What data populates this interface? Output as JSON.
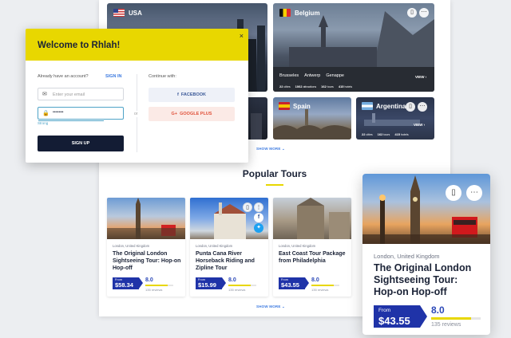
{
  "destinations": [
    {
      "name": "USA",
      "flag": "us"
    },
    {
      "name": "Belgium",
      "flag": "be",
      "cities": [
        "Brusseles",
        "Antwerp",
        "Genappe"
      ],
      "stats": [
        {
          "n": "22",
          "l": "cities"
        },
        {
          "n": "1062",
          "l": "attractions"
        },
        {
          "n": "162",
          "l": "tours"
        },
        {
          "n": "415",
          "l": "hotels"
        }
      ],
      "view": "VIEW ›"
    },
    {
      "name": "Spain",
      "flag": "es"
    },
    {
      "name": "Argentina",
      "flag": "ar",
      "stats": [
        {
          "n": "22",
          "l": "cities"
        },
        {
          "n": "162",
          "l": "tours"
        },
        {
          "n": "415",
          "l": "hotels"
        }
      ],
      "view": "VIEW ›"
    }
  ],
  "show_more_1": "SHOW MORE ⌄",
  "popular": {
    "title": "Popular Tours",
    "cards": [
      {
        "loc": "London, United Kingdom",
        "title": "The Original London Sightseeing Tour: Hop-on Hop-off",
        "from": "From",
        "price": "$58.34",
        "rating": "8.0",
        "rating_value": 0.8,
        "reviews": "135 reviews"
      },
      {
        "loc": "London, United Kingdom",
        "title": "Punta Cana River Horseback Riding and Zipline Tour",
        "from": "From",
        "price": "$15.99",
        "rating": "8.0",
        "rating_value": 0.8,
        "reviews": "135 reviews"
      },
      {
        "loc": "London, United Kingdom",
        "title": "East Coast Tour Package from Philadelphia",
        "from": "From",
        "price": "$43.55",
        "rating": "8.0",
        "rating_value": 0.8,
        "reviews": "135 reviews"
      }
    ],
    "show_more": "SHOW MORE ⌄"
  },
  "modal": {
    "title": "Welcome to Rhlah!",
    "close": "×",
    "have_account": "Already have an account?",
    "sign_in": "SIGN IN",
    "email_placeholder": "Enter your email",
    "password": "•••••••",
    "strength": "Strong",
    "or": "or",
    "signup": "SIGN UP",
    "continue_with": "Continue with:",
    "facebook": "FACEBOOK",
    "google": "GOOGLE PLUS"
  },
  "big_card": {
    "loc": "London, United Kingdom",
    "title": "The Original London Sightseeing Tour: Hop-on Hop-off",
    "from": "From",
    "price": "$43.55",
    "rating": "8.0",
    "rating_value": 0.8,
    "reviews": "135 reviews"
  },
  "colors": {
    "accent_yellow": "#e8d700",
    "price_blue": "#1f33a8",
    "link_blue": "#3b79e0",
    "google_red": "#e0513a",
    "facebook_blue": "#3b5998"
  }
}
